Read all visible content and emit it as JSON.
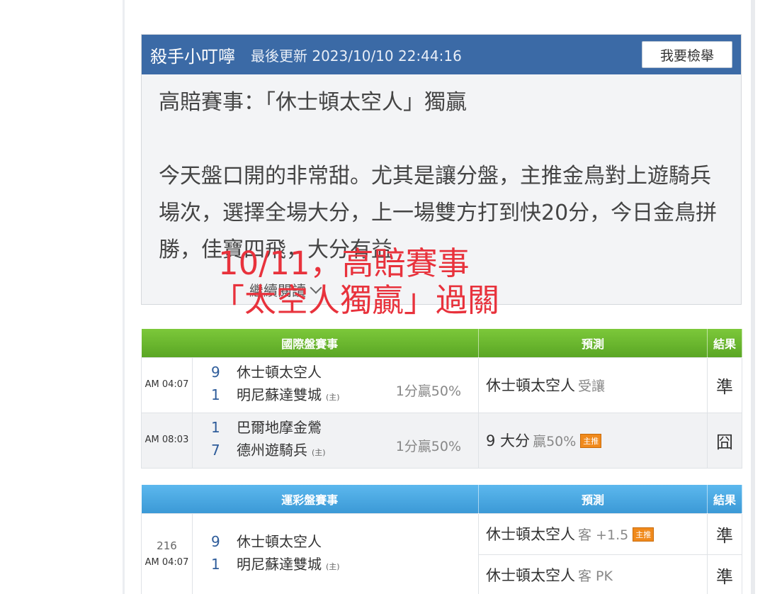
{
  "post": {
    "author": "殺手小叮嚀",
    "update_label": "最後更新 2023/10/10 22:44:16",
    "report_label": "我要檢舉",
    "title": "高賠賽事：「休士頓太空人」獨贏",
    "paragraph": "今天盤口開的非常甜。尤其是讓分盤，主推金鳥對上遊騎兵場次，選擇全場大分，上一場雙方打到快20分，今日金鳥拼勝，佳寶四飛，大分有益",
    "read_more": "繼續閱讀"
  },
  "overlay": {
    "line1": "10/11，高賠賽事",
    "line2": "「太空人獨贏」過關"
  },
  "intl_table": {
    "headers": [
      "國際盤賽事",
      "預測",
      "結果"
    ],
    "rows": [
      {
        "time": "AM 04:07",
        "away_score": "9",
        "away_team": "休士頓太空人",
        "home_score": "1",
        "home_team": "明尼蘇達雙城",
        "home_tag": "(主)",
        "handicap": "1分贏50%",
        "pick": "休士頓太空人",
        "pick_sub": "受讓",
        "badge": "",
        "result": "準"
      },
      {
        "time": "AM 08:03",
        "away_score": "1",
        "away_team": "巴爾地摩金鶯",
        "home_score": "7",
        "home_team": "德州遊騎兵",
        "home_tag": "(主)",
        "handicap": "1分贏50%",
        "pick": "9 大分",
        "pick_sub": "贏50%",
        "badge": "主推",
        "result": "囧"
      }
    ]
  },
  "lottery_table": {
    "headers": [
      "運彩盤賽事",
      "預測",
      "結果"
    ],
    "row": {
      "number": "216",
      "time": "AM 04:07",
      "away_score": "9",
      "away_team": "休士頓太空人",
      "home_score": "1",
      "home_team": "明尼蘇達雙城",
      "home_tag": "(主)",
      "picks": [
        {
          "pick": "休士頓太空人",
          "pick_sub": "客 +1.5",
          "badge": "主推",
          "result": "準"
        },
        {
          "pick": "休士頓太空人",
          "pick_sub": "客 PK",
          "badge": "",
          "result": "準"
        }
      ]
    }
  },
  "colors": {
    "header_blue": "#3b6aa6",
    "green_header": "#6cb82e",
    "blue_header": "#49a8e2",
    "overlay_red": "#e8323c",
    "win_green": "#3a9a2a",
    "badge_orange": "#f08a1c"
  }
}
